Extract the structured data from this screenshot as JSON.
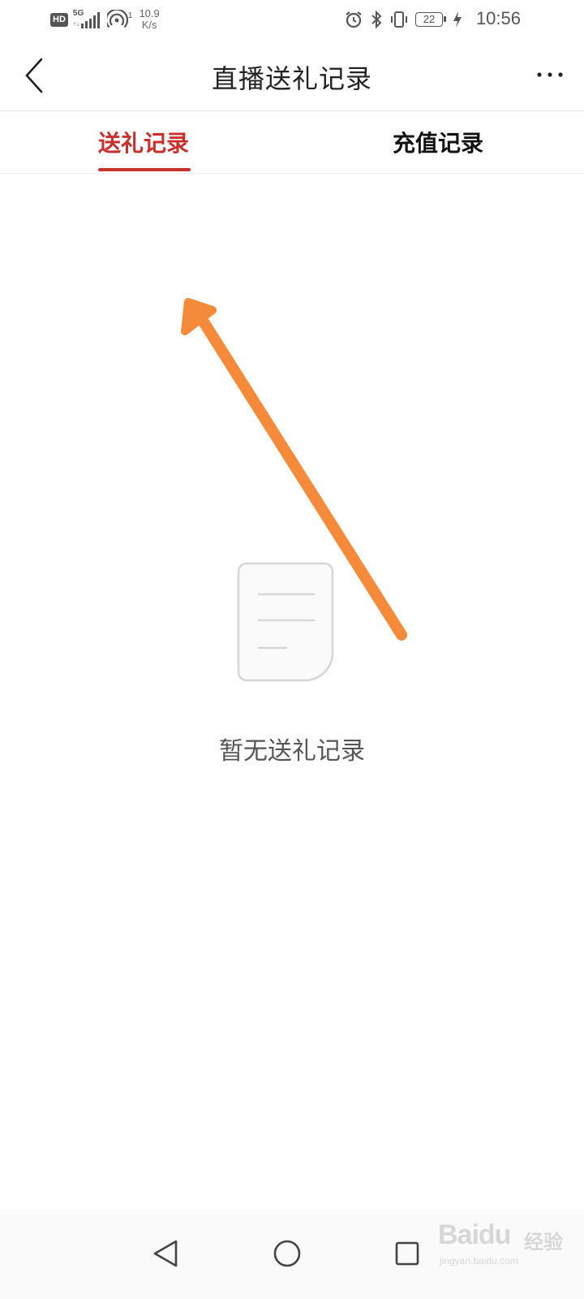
{
  "status_bar": {
    "hd": "HD",
    "network": "5G",
    "network_sub": "↑↓",
    "hotspot_count": "1",
    "speed_value": "10.9",
    "speed_unit": "K/s",
    "battery": "22",
    "time": "10:56",
    "icons": [
      "alarm-icon",
      "bluetooth-icon",
      "vibrate-icon",
      "charging-icon"
    ]
  },
  "header": {
    "title": "直播送礼记录",
    "back_icon": "chevron-left-icon",
    "more_icon": "more-horizontal-icon"
  },
  "tabs": [
    {
      "label": "送礼记录",
      "active": true
    },
    {
      "label": "充值记录",
      "active": false
    }
  ],
  "empty_state": {
    "icon": "empty-document-icon",
    "message": "暂无送礼记录"
  },
  "annotation": {
    "icon": "arrow-annotation",
    "color": "#f58a3a"
  },
  "nav_bar": {
    "icons": [
      "nav-back-icon",
      "nav-home-icon",
      "nav-recent-icon"
    ]
  },
  "watermark": {
    "brand": "Baidu",
    "brand_cn": "经验",
    "url": "jingyan.baidu.com"
  },
  "colors": {
    "accent": "#c8302c",
    "text": "#222222",
    "muted": "#555555"
  }
}
